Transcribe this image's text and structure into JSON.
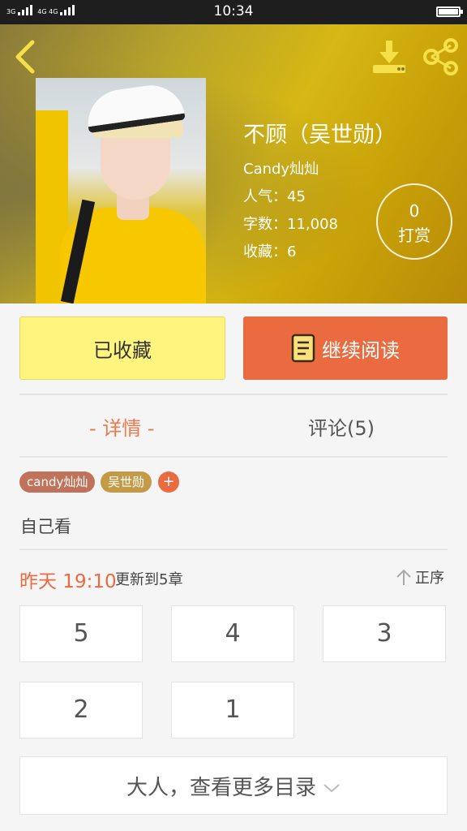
{
  "status_bar": {
    "network_1": "3G",
    "network_2": "4G 4G",
    "time": "10:34"
  },
  "header": {
    "back_icon": "chevron-left-icon",
    "download_icon": "download-icon",
    "share_icon": "share-icon",
    "icon_color": "#f5e04a"
  },
  "book": {
    "title": "不顾（吴世勋）",
    "author": "Candy灿灿",
    "popularity": "人气：45",
    "word_count": "字数：11,008",
    "favorites": "收藏：6",
    "reward_count": "0",
    "reward_label": "打赏"
  },
  "actions": {
    "favorite_label": "已收藏",
    "read_label": "继续阅读",
    "favorite_color": "#fff57e",
    "read_color": "#ea6b40"
  },
  "tabs": [
    {
      "label": "- 详情 -",
      "active": true
    },
    {
      "label": "评论(5)",
      "active": false
    }
  ],
  "tags": [
    "candy灿灿",
    "吴世勋",
    "+"
  ],
  "description": "自己看",
  "update": {
    "time": "昨天 19:10",
    "text": "更新到5章",
    "sort_label": "正序"
  },
  "chapters": [
    "5",
    "4",
    "3",
    "2",
    "1"
  ],
  "more_label": "大人，查看更多目录"
}
